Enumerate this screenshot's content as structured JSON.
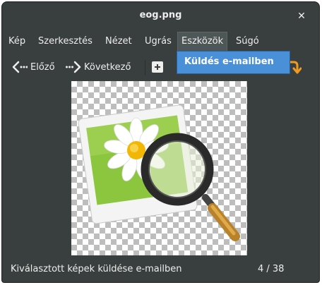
{
  "window": {
    "title": "eog.png"
  },
  "menubar": {
    "items": [
      "Kép",
      "Szerkesztés",
      "Nézet",
      "Ugrás",
      "Eszközök",
      "Súgó"
    ]
  },
  "dropdown": {
    "item": "Küldés e-mailben"
  },
  "toolbar": {
    "prev_label": "Előző",
    "next_label": "Következő"
  },
  "statusbar": {
    "message": "Kiválasztott képek küldése e-mailben",
    "counter": "4 / 38"
  },
  "icons": {
    "close": "close-icon",
    "prev": "go-previous-icon",
    "next": "go-next-icon",
    "zoom": "zoom-fit-icon",
    "rotate": "rotate-icon"
  },
  "colors": {
    "window_bg": "#393f3f",
    "menu_highlight": "#4a90d9",
    "rotate_accent": "#f09a20"
  }
}
